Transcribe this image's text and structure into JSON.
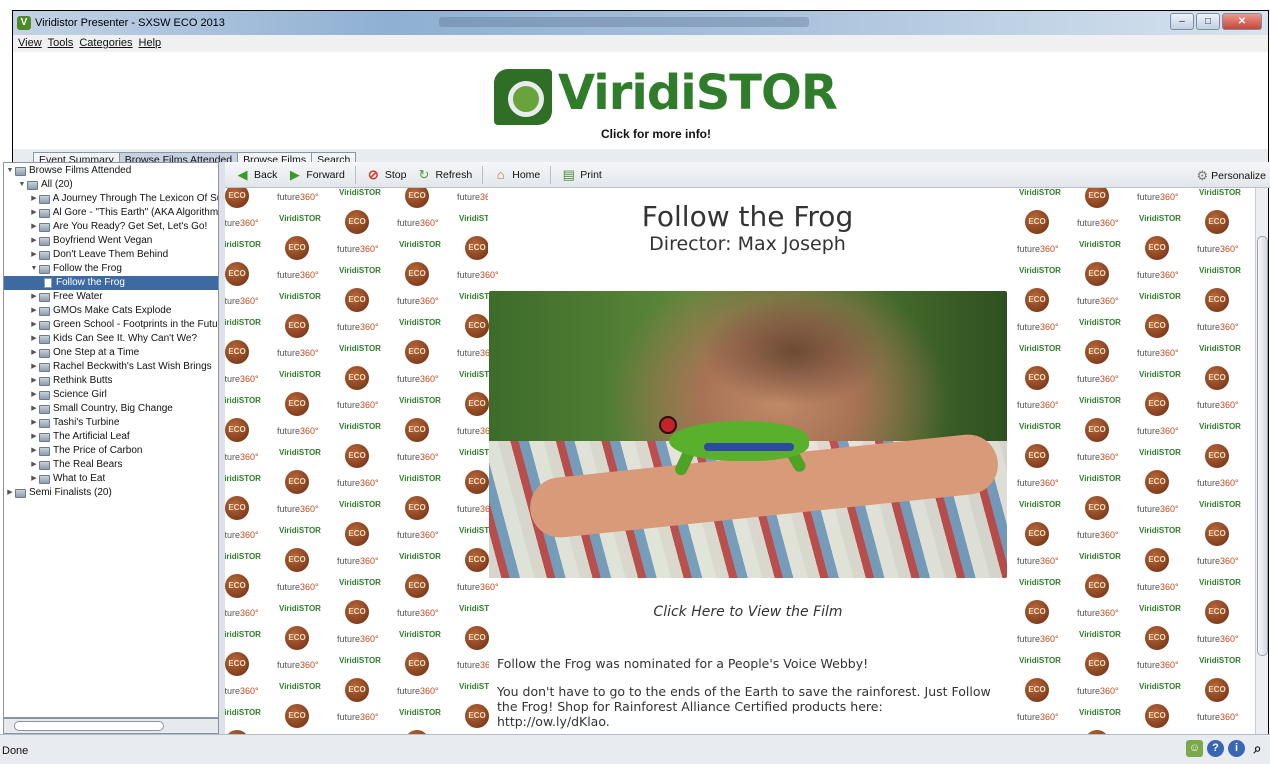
{
  "window": {
    "title": "Viridistor Presenter - SXSW ECO 2013",
    "controls": {
      "minimize": "–",
      "maximize": "□",
      "close": "✕"
    }
  },
  "menu": [
    "View",
    "Tools",
    "Categories",
    "Help"
  ],
  "banner": {
    "logo_text": "ViridiSTOR",
    "logo_sub": "Click for more info!"
  },
  "tabs": [
    {
      "label": "Event Summary",
      "active": false
    },
    {
      "label": "Browse Films Attended",
      "active": true
    },
    {
      "label": "Browse Films",
      "active": false
    },
    {
      "label": "Search",
      "active": false
    }
  ],
  "tree": {
    "root": "Browse Films Attended",
    "all": "All (20)",
    "items": [
      "A Journey Through The Lexicon Of Su",
      "Al Gore - \"This Earth\" (AKA Algorithm:",
      "Are You Ready? Get Set, Let's Go!",
      "Boyfriend Went Vegan",
      "Don't Leave Them Behind",
      "Follow the Frog",
      "Follow the Frog",
      "Free Water",
      "GMOs Make Cats Explode",
      "Green School - Footprints in the Futu",
      "Kids Can See It. Why Can't We?",
      "One Step at a Time",
      "Rachel Beckwith's Last Wish Brings",
      "Rethink Butts",
      "Science Girl",
      "Small Country, Big Change",
      "Tashi's Turbine",
      "The Artificial Leaf",
      "The Price of Carbon",
      "The Real Bears",
      "What to Eat"
    ],
    "semi": "Semi Finalists (20)"
  },
  "browser_toolbar": {
    "back": "Back",
    "forward": "Forward",
    "stop": "Stop",
    "refresh": "Refresh",
    "home": "Home",
    "print": "Print",
    "personalize": "Personalize"
  },
  "film": {
    "title": "Follow the Frog",
    "director": "Director: Max Joseph",
    "view_link": "Click Here to View the Film",
    "desc1": "Follow the Frog was nominated for a People's Voice Webby!",
    "desc2": "You don't have to go to the ends of the Earth to save the rainforest. Just Follow the Frog! Shop for Rainforest Alliance Certified products here: http://ow.ly/dKlao."
  },
  "pattern": {
    "eco": "ECO",
    "future": "future",
    "future_num": "360°",
    "viridistor": "ViridiSTOR"
  },
  "status": {
    "text": "Done"
  },
  "colors": {
    "accent": "#3d6aa0",
    "brand_green": "#2f7d2a"
  }
}
